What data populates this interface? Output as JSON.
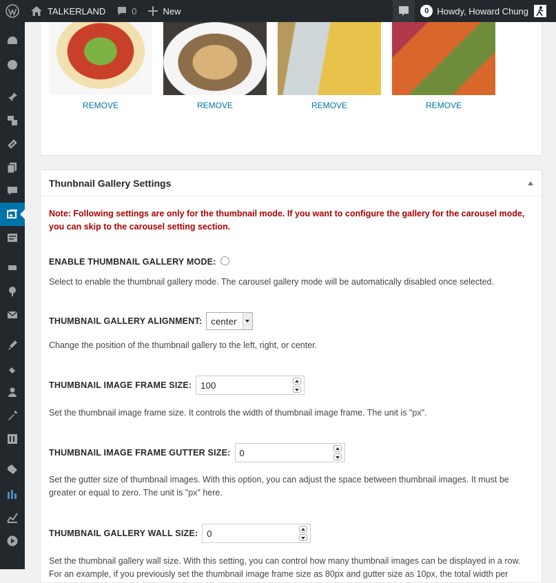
{
  "admin_bar": {
    "site_name": "TALKERLAND",
    "comments_count": "0",
    "new_label": "New",
    "notifications_count": "0",
    "greeting": "Howdy, Howard Chung"
  },
  "sidebar": {
    "items": [
      "dashboard-icon",
      "jetpack-icon",
      "pin-icon",
      "media-icon",
      "links-icon",
      "pages-icon",
      "comments-icon",
      "gallery-icon",
      "forms-icon",
      "woo-icon",
      "feedback-icon",
      "mail-icon",
      "appearance-icon",
      "plugins-icon",
      "users-icon",
      "tools-icon",
      "settings-icon",
      "tag-icon",
      "analytics-icon",
      "chart-icon",
      "play-icon"
    ],
    "active_index": 7
  },
  "gallery": {
    "remove_label": "REMOVE",
    "thumbs": [
      {
        "alt": "salad bowl",
        "colors": [
          "#c9402a",
          "#7cb342",
          "#f2e0b0"
        ]
      },
      {
        "alt": "stir-fried noodles",
        "colors": [
          "#8d6e4a",
          "#d9b27a",
          "#f5f5f5"
        ]
      },
      {
        "alt": "pasta nests",
        "colors": [
          "#e8c24a",
          "#cfd6d8",
          "#b69a5b"
        ]
      },
      {
        "alt": "colored pasta",
        "colors": [
          "#d9662b",
          "#6e8c3a",
          "#b03a4a"
        ]
      }
    ]
  },
  "settings_panel": {
    "title": "Thunbnail Gallery Settings",
    "note": "Note: Following settings are only for the thumbnail mode. If you want to configure the gallery for the carousel mode, you can skip to the carousel setting section.",
    "enable_label": "ENABLE THUMBNAIL GALLERY MODE:",
    "enable_desc": "Select to enable the thumbnail gallery mode. The carousel gallery mode will be automatically disabled once selected.",
    "alignment_label": "THUMBNAIL GALLERY ALIGNMENT:",
    "alignment_value": "center",
    "alignment_desc": "Change the position of the thumbnail gallery to the left, right, or center.",
    "frame_label": "THUMBNAIL IMAGE FRAME SIZE:",
    "frame_value": "100",
    "frame_desc": "Set the thumbnail image frame size. It controls the width of thumbnail image frame. The unit is \"px\".",
    "gutter_label": "THUMBNAIL IMAGE FRAME GUTTER SIZE:",
    "gutter_value": "0",
    "gutter_desc": "Set the gutter size of thumbnail images. With this option, you can adjust the space between thumbnail images. It must be greater or equal to zero. The unit is \"px\" here.",
    "wall_label": "THUMBNAIL GALLERY WALL SIZE:",
    "wall_value": "0",
    "wall_desc": "Set the thumbnail gallery wall size. With this setting, you can control how many thumbnail images can be displayed in a row. For an example, if you previously set the thumbnail image frame size as 80px and gutter size as 10px, the total width per"
  },
  "colors": {
    "admin_bar": "#23282d",
    "accent": "#0073aa",
    "note": "#aa0000"
  }
}
